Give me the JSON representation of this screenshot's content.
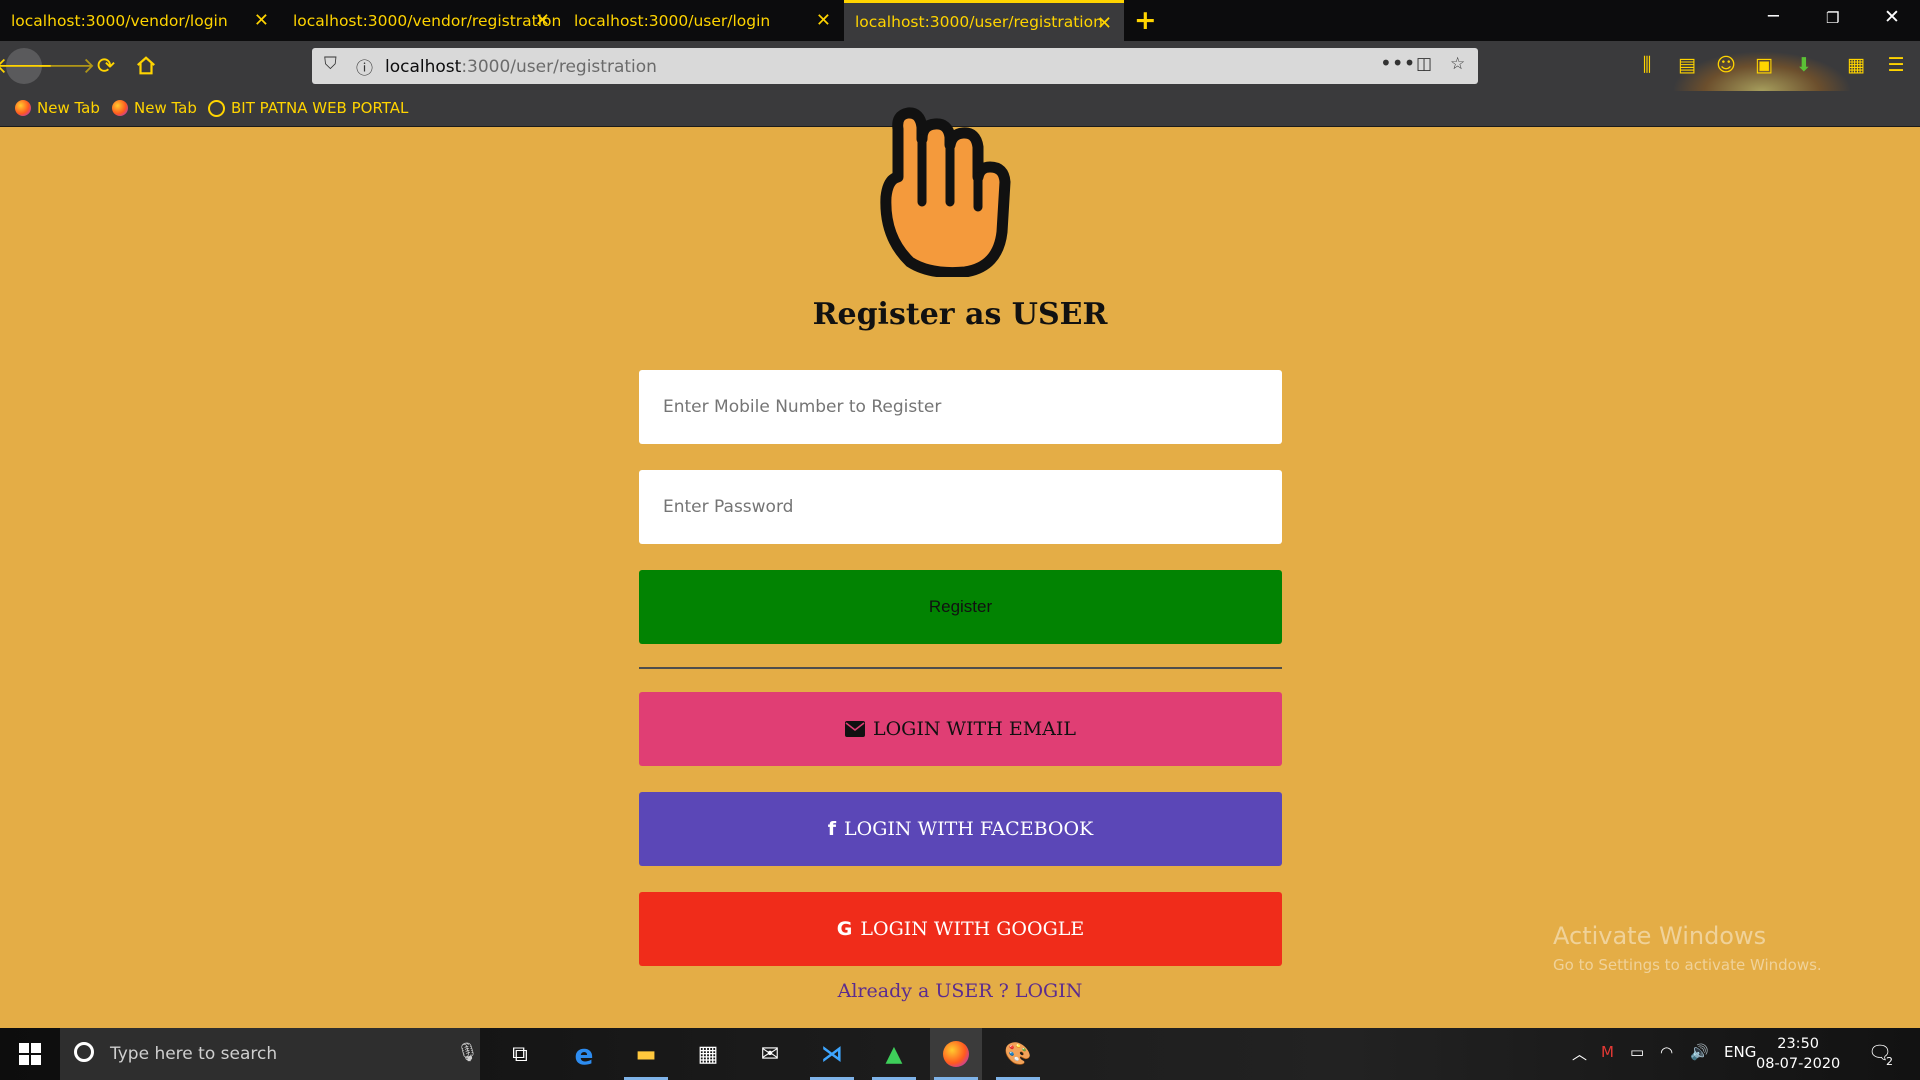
{
  "browser": {
    "tabs": [
      {
        "label": "localhost:3000/vendor/login",
        "active": false
      },
      {
        "label": "localhost:3000/vendor/registration",
        "active": false
      },
      {
        "label": "localhost:3000/user/login",
        "active": false
      },
      {
        "label": "localhost:3000/user/registration",
        "active": true
      }
    ],
    "url_host": "localhost",
    "url_path": ":3000/user/registration",
    "bookmarks": [
      "New Tab",
      "New Tab",
      "BIT PATNA WEB PORTAL"
    ],
    "accent_color": "#ffd400"
  },
  "page": {
    "title": "Register as USER",
    "mobile_placeholder": "Enter Mobile Number to Register",
    "password_placeholder": "Enter Password",
    "register_label": "Register",
    "email_label": "LOGIN WITH EMAIL",
    "facebook_label": "LOGIN WITH FACEBOOK",
    "google_label": "LOGIN WITH GOOGLE",
    "login_link": "Already a USER ? LOGIN",
    "background_color": "#e4ad46"
  },
  "watermark": {
    "title": "Activate Windows",
    "subtitle": "Go to Settings to activate Windows."
  },
  "taskbar": {
    "search_placeholder": "Type here to search",
    "language": "ENG",
    "time": "23:50",
    "date": "08-07-2020",
    "notification_count": "2"
  }
}
